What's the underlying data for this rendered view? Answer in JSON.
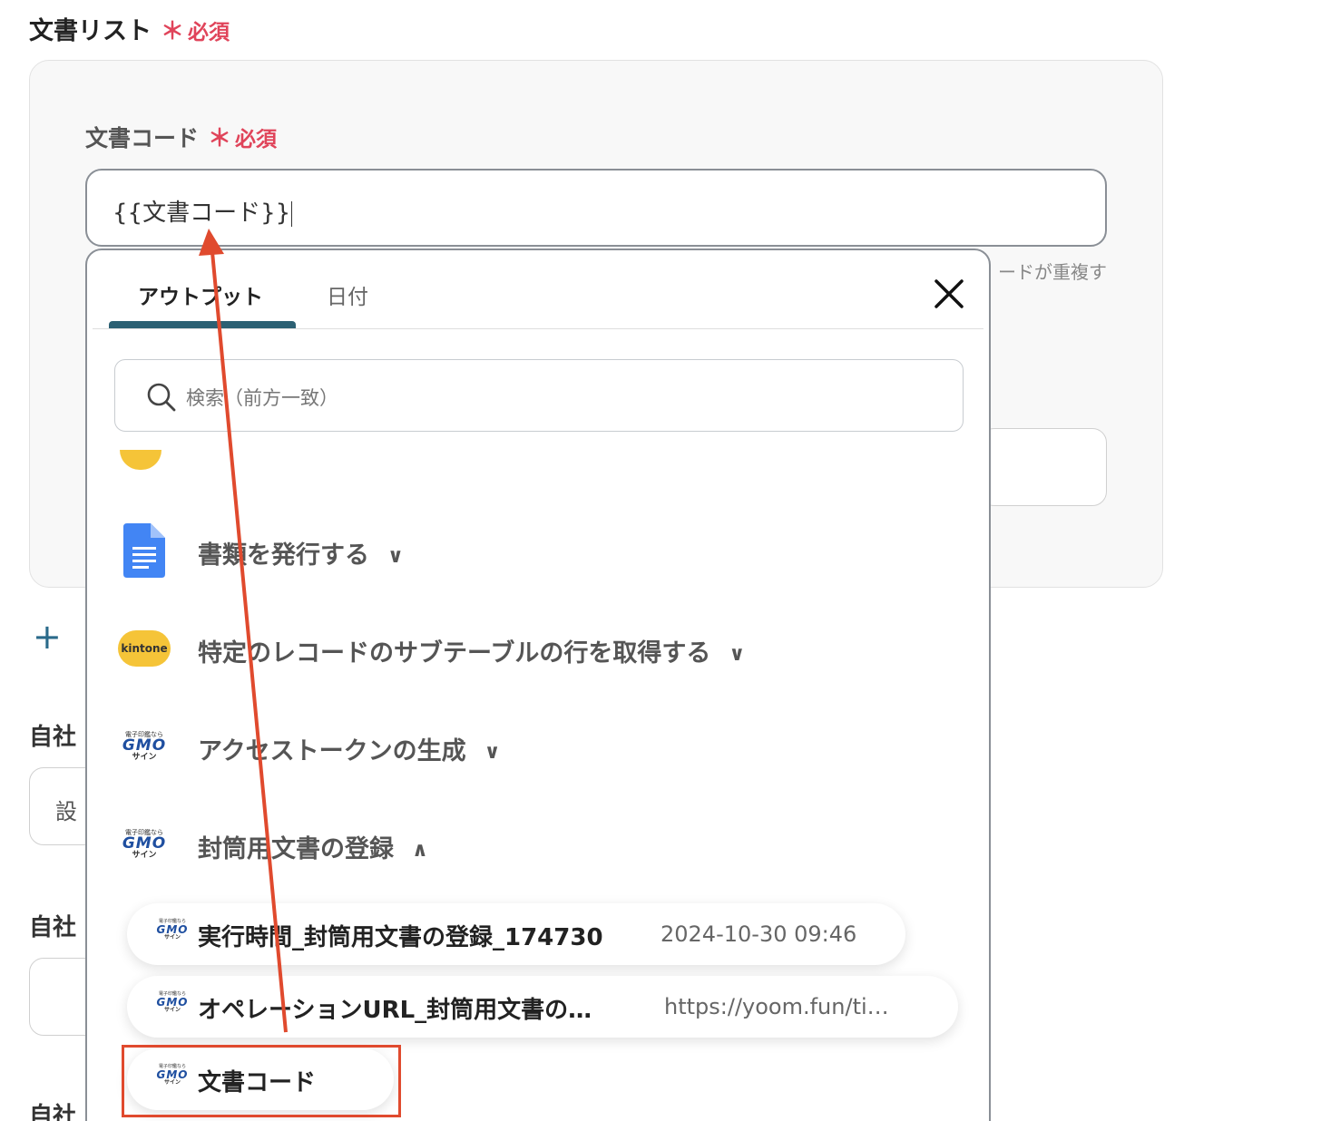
{
  "header": {
    "section_label": "文書リスト",
    "required_star": "＊",
    "required_text": "必須"
  },
  "code_field": {
    "label": "文書コード",
    "required_star": "＊",
    "required_text": "必須",
    "value": "{{文書コード}}",
    "help_text": "ードが重複す"
  },
  "background": {
    "add_icon": "plus-icon",
    "labels": [
      "自社",
      "自社",
      "自社"
    ],
    "input_text": "設"
  },
  "popup": {
    "tabs": [
      {
        "label": "アウトプット",
        "active": true
      },
      {
        "label": "日付",
        "active": false
      }
    ],
    "search_placeholder": "検索（前方一致）",
    "operations": [
      {
        "label": "書類を発行する",
        "icon": "google-docs-icon",
        "expanded": false
      },
      {
        "label": "特定のレコードのサブテーブルの行を取得する",
        "icon": "kintone-icon",
        "expanded": false
      },
      {
        "label": "アクセストークンの生成",
        "icon": "gmo-sign-icon",
        "expanded": false
      },
      {
        "label": "封筒用文書の登録",
        "icon": "gmo-sign-icon",
        "expanded": true
      }
    ],
    "outputs": [
      {
        "label": "実行時間_封筒用文書の登録_174730",
        "value": "2024-10-30 09:46"
      },
      {
        "label": "オペレーションURL_封筒用文書の…",
        "value": "https://yoom.fun/ti…"
      },
      {
        "label": "文書コード",
        "value": ""
      }
    ]
  },
  "logos": {
    "kintone": "kintone",
    "gmo_top": "電子印鑑なら",
    "gmo_mid": "GMO",
    "gmo_bot": "サイン"
  },
  "colors": {
    "required": "#e0445a",
    "tab_active": "#2c6073",
    "annotation": "#e04a2e"
  }
}
